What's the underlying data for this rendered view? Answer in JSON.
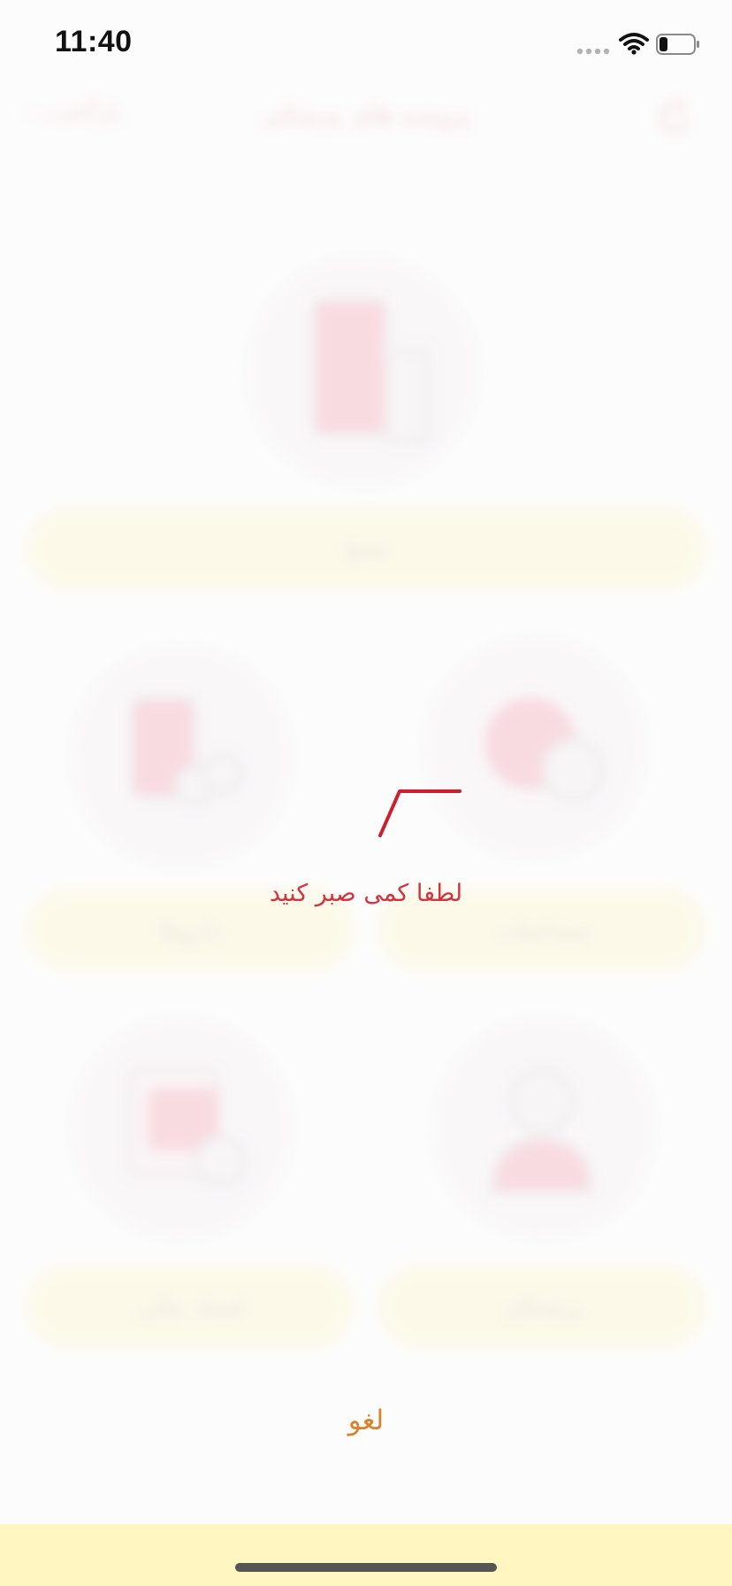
{
  "status_bar": {
    "time": "11:40",
    "icons": [
      "signal-dots-icon",
      "wifi-icon",
      "battery-icon"
    ],
    "battery_level": 0.25
  },
  "background_app": {
    "nav": {
      "title": "پرونده های پزشکی",
      "back_label": "بازگشت",
      "refresh_icon": "refresh-icon"
    },
    "tiles": [
      {
        "label": "نسخ",
        "icon": "prescription-icon"
      },
      {
        "label": "داروها",
        "icon": "medicine-bottle-icon"
      },
      {
        "label": "مصاحبات",
        "icon": "lab-test-icon"
      },
      {
        "label": "اسناد مالی",
        "icon": "documents-icon"
      },
      {
        "label": "پزشکان",
        "icon": "doctor-icon"
      }
    ]
  },
  "loader": {
    "wait_text": "لطفا کمی صبر کنید",
    "cancel_label": "لغو"
  },
  "colors": {
    "accent_red": "#d3323e",
    "cancel_orange": "#d9822b",
    "band_yellow": "#fbf4c8"
  }
}
